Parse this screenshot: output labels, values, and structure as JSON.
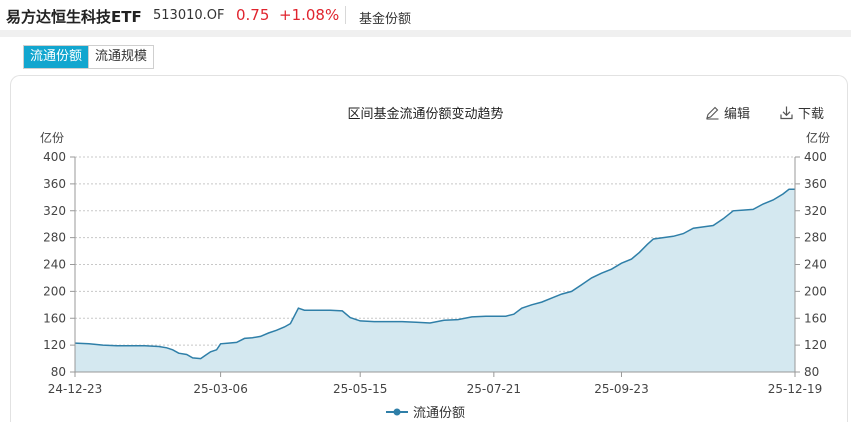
{
  "header": {
    "fund_name": "易方达恒生科技ETF",
    "fund_code": "513010.OF",
    "price": "0.75",
    "change_pct": "+1.08%",
    "metric_label": "基金份额"
  },
  "tabs": [
    {
      "label": "流通份额",
      "active": true
    },
    {
      "label": "流通规模",
      "active": false
    }
  ],
  "actions": {
    "edit_label": "编辑",
    "download_label": "下载",
    "edit_icon": "pencil-icon",
    "download_icon": "download-icon"
  },
  "colors": {
    "up": "#e0242e",
    "accent": "#12a6cf",
    "series_line": "#2f7fa8",
    "series_fill": "#d4e8f0"
  },
  "chart_data": {
    "type": "area",
    "title": "区间基金流通份额变动趋势",
    "ylabel_left": "亿份",
    "ylabel_right": "亿份",
    "ylim": [
      80,
      400
    ],
    "yticks": [
      80,
      120,
      160,
      200,
      240,
      280,
      320,
      360,
      400
    ],
    "x_start": "24-12-23",
    "x_end": "25-12-19",
    "xtick_labels": [
      "24-12-23",
      "25-03-06",
      "25-05-15",
      "25-07-21",
      "25-09-23",
      "25-12-19"
    ],
    "grid": true,
    "legend_position": "bottom-center",
    "series": [
      {
        "name": "流通份额",
        "points": [
          [
            "24-12-23",
            123
          ],
          [
            "24-12-30",
            122
          ],
          [
            "25-01-06",
            120
          ],
          [
            "25-01-13",
            119
          ],
          [
            "25-01-20",
            119
          ],
          [
            "25-01-27",
            119
          ],
          [
            "25-02-03",
            118
          ],
          [
            "25-02-07",
            116
          ],
          [
            "25-02-10",
            113
          ],
          [
            "25-02-13",
            108
          ],
          [
            "25-02-17",
            106
          ],
          [
            "25-02-20",
            101
          ],
          [
            "25-02-24",
            100
          ],
          [
            "25-02-26",
            104
          ],
          [
            "25-03-01",
            110
          ],
          [
            "25-03-04",
            113
          ],
          [
            "25-03-06",
            122
          ],
          [
            "25-03-10",
            123
          ],
          [
            "25-03-14",
            124
          ],
          [
            "25-03-18",
            130
          ],
          [
            "25-03-22",
            131
          ],
          [
            "25-03-26",
            133
          ],
          [
            "25-03-30",
            138
          ],
          [
            "25-04-03",
            142
          ],
          [
            "25-04-07",
            147
          ],
          [
            "25-04-10",
            152
          ],
          [
            "25-04-14",
            175
          ],
          [
            "25-04-17",
            172
          ],
          [
            "25-04-23",
            172
          ],
          [
            "25-04-30",
            172
          ],
          [
            "25-05-06",
            171
          ],
          [
            "25-05-10",
            161
          ],
          [
            "25-05-15",
            156
          ],
          [
            "25-05-22",
            155
          ],
          [
            "25-05-29",
            155
          ],
          [
            "25-06-05",
            155
          ],
          [
            "25-06-12",
            154
          ],
          [
            "25-06-19",
            153
          ],
          [
            "25-06-26",
            157
          ],
          [
            "25-07-03",
            158
          ],
          [
            "25-07-10",
            162
          ],
          [
            "25-07-17",
            163
          ],
          [
            "25-07-21",
            163
          ],
          [
            "25-07-27",
            163
          ],
          [
            "25-07-31",
            166
          ],
          [
            "25-08-04",
            175
          ],
          [
            "25-08-09",
            180
          ],
          [
            "25-08-14",
            184
          ],
          [
            "25-08-19",
            190
          ],
          [
            "25-08-24",
            196
          ],
          [
            "25-08-29",
            200
          ],
          [
            "25-09-03",
            210
          ],
          [
            "25-09-08",
            220
          ],
          [
            "25-09-13",
            227
          ],
          [
            "25-09-18",
            233
          ],
          [
            "25-09-23",
            242
          ],
          [
            "25-09-28",
            248
          ],
          [
            "25-10-02",
            258
          ],
          [
            "25-10-06",
            270
          ],
          [
            "25-10-09",
            278
          ],
          [
            "25-10-14",
            280
          ],
          [
            "25-10-19",
            282
          ],
          [
            "25-10-24",
            286
          ],
          [
            "25-10-29",
            294
          ],
          [
            "25-11-03",
            296
          ],
          [
            "25-11-08",
            298
          ],
          [
            "25-11-13",
            308
          ],
          [
            "25-11-18",
            320
          ],
          [
            "25-11-23",
            321
          ],
          [
            "25-11-28",
            322
          ],
          [
            "25-12-03",
            330
          ],
          [
            "25-12-08",
            336
          ],
          [
            "25-12-13",
            345
          ],
          [
            "25-12-16",
            352
          ],
          [
            "25-12-19",
            352
          ]
        ]
      }
    ]
  }
}
